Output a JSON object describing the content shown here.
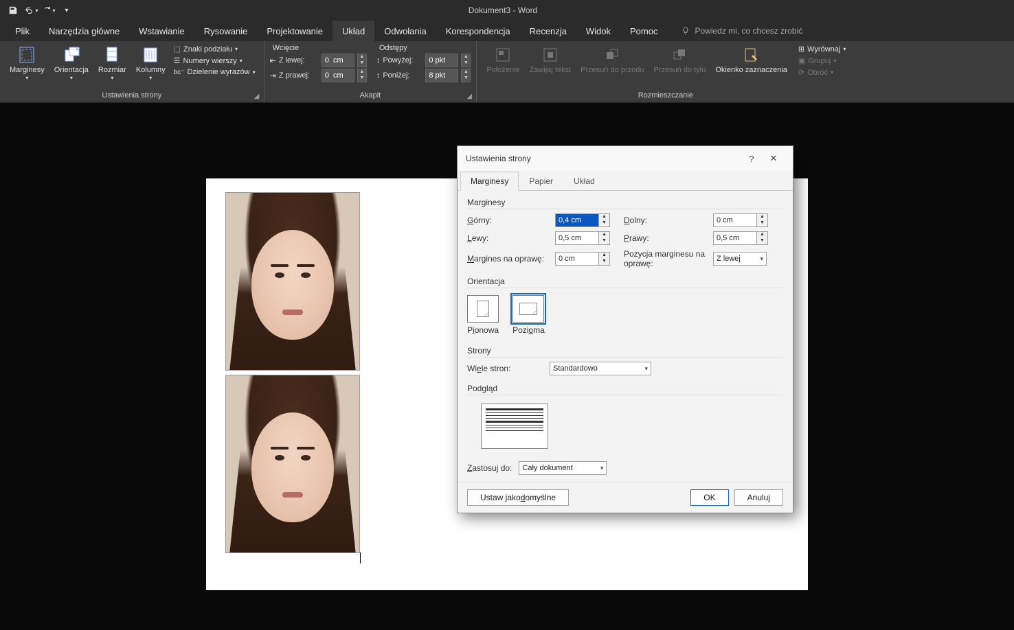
{
  "title": "Dokument3  -  Word",
  "tabs": [
    "Plik",
    "Narzędzia główne",
    "Wstawianie",
    "Rysowanie",
    "Projektowanie",
    "Układ",
    "Odwołania",
    "Korespondencja",
    "Recenzja",
    "Widok",
    "Pomoc"
  ],
  "active_tab": "Układ",
  "tell_me": "Powiedz mi, co chcesz zrobić",
  "ribbon": {
    "page_setup": {
      "label": "Ustawienia strony",
      "margins": "Marginesy",
      "orientation": "Orientacja",
      "size": "Rozmiar",
      "columns": "Kolumny",
      "breaks": "Znaki podziału",
      "line_numbers": "Numery wierszy",
      "hyphenation": "Dzielenie wyrazów"
    },
    "paragraph": {
      "label": "Akapit",
      "indent": "Wcięcie",
      "spacing": "Odstępy",
      "left": "Z lewej:",
      "right": "Z prawej:",
      "before": "Powyżej:",
      "after": "Poniżej:",
      "left_val": "0  cm",
      "right_val": "0  cm",
      "before_val": "0 pkt",
      "after_val": "8 pkt"
    },
    "arrange": {
      "label": "Rozmieszczanie",
      "position": "Położenie",
      "wrap": "Zawijaj tekst",
      "forward": "Przesuń do przodu",
      "backward": "Przesuń do tyłu",
      "selection_pane": "Okienko zaznaczenia",
      "align": "Wyrównaj",
      "group": "Grupuj",
      "rotate": "Obróć"
    }
  },
  "dialog": {
    "title": "Ustawienia strony",
    "tabs": [
      "Marginesy",
      "Papier",
      "Układ"
    ],
    "margins_section": "Marginesy",
    "top_label": "Górny:",
    "bottom_label": "Dolny:",
    "left_label": "Lewy:",
    "right_label": "Prawy:",
    "gutter_label": "Margines na oprawę:",
    "gutter_pos_label": "Pozycja marginesu na oprawę:",
    "top_val": "0,4 cm",
    "bottom_val": "0 cm",
    "left_val": "0,5 cm",
    "right_val": "0,5 cm",
    "gutter_val": "0 cm",
    "gutter_pos_val": "Z lewej",
    "orientation_section": "Orientacja",
    "portrait": "Pionowa",
    "landscape": "Pozioma",
    "pages_section": "Strony",
    "multi_pages_label": "Wiele stron:",
    "multi_pages_val": "Standardowo",
    "preview_section": "Podgląd",
    "apply_to_label": "Zastosuj do:",
    "apply_to_val": "Cały dokument",
    "set_default": "Ustaw jako domyślne",
    "ok": "OK",
    "cancel": "Anuluj"
  }
}
